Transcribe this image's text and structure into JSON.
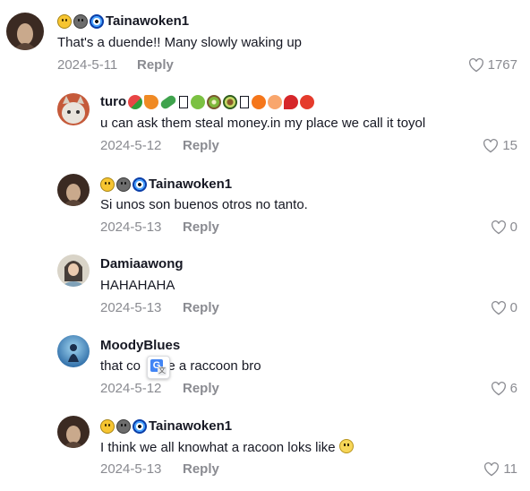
{
  "colors": {
    "text": "#161823",
    "muted": "#8a8b91",
    "background": "#ffffff"
  },
  "comments": [
    {
      "username": "Tainawoken1",
      "username_emojis": [
        "smiley-icon",
        "grey-face-icon",
        "nazar-eye-icon"
      ],
      "text": "That's a duende!! Many slowly waking up",
      "date": "2024-5-11",
      "reply": "Reply",
      "likes": "1767"
    },
    {
      "username": "turo",
      "username_emojis": [
        "watermelon-icon",
        "carrot-icon",
        "cucumber-icon",
        "missing-glyph-icon",
        "green-apple-icon",
        "kiwi-icon",
        "avocado-icon",
        "missing-glyph-icon",
        "tangerine-icon",
        "peach-icon",
        "chili-icon",
        "tomato-icon"
      ],
      "text": "u can ask them steal money.in my place we call it toyol",
      "date": "2024-5-12",
      "reply": "Reply",
      "likes": "15"
    },
    {
      "username": "Tainawoken1",
      "username_emojis": [
        "smiley-icon",
        "grey-face-icon",
        "nazar-eye-icon"
      ],
      "text": "Si unos son buenos otros no tanto.",
      "date": "2024-5-13",
      "reply": "Reply",
      "likes": "0"
    },
    {
      "username": "Damiaawong",
      "text": "HAHAHAHA",
      "date": "2024-5-13",
      "reply": "Reply",
      "likes": "0"
    },
    {
      "username": "MoodyBlues",
      "text_before": "that co",
      "text_after": "be a raccoon bro",
      "date": "2024-5-12",
      "reply": "Reply",
      "likes": "6"
    },
    {
      "username": "Tainawoken1",
      "username_emojis": [
        "smiley-icon",
        "grey-face-icon",
        "nazar-eye-icon"
      ],
      "text": "I think we all knowhat a racoon loks like",
      "text_emoji": "rolling-eyes-icon",
      "date": "2024-5-13",
      "reply": "Reply",
      "likes": "11"
    }
  ]
}
